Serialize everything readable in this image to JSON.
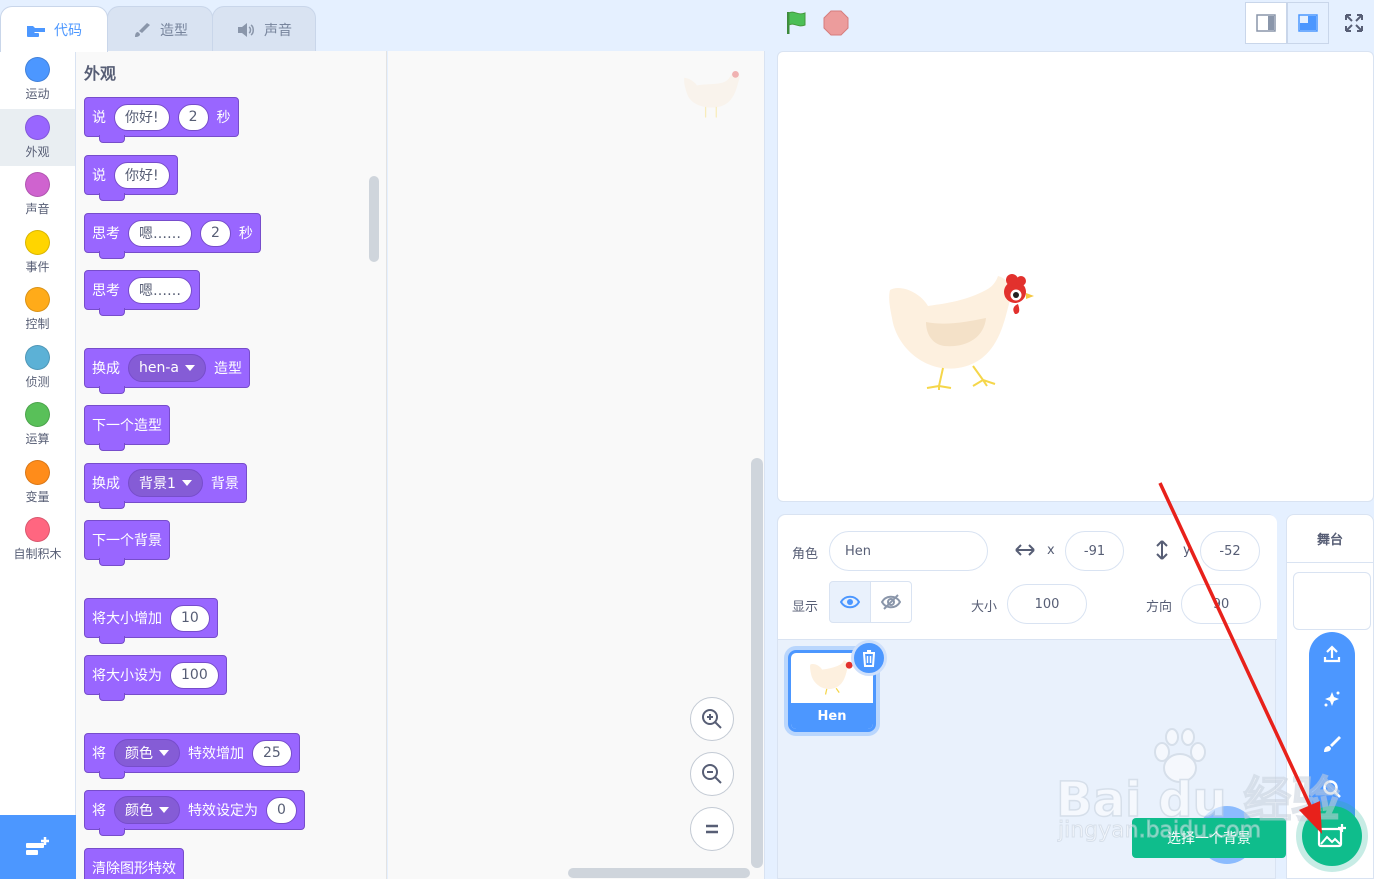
{
  "tabs": [
    {
      "label": "代码",
      "icon": "code-icon",
      "active": true
    },
    {
      "label": "造型",
      "icon": "brush-icon",
      "active": false
    },
    {
      "label": "声音",
      "icon": "speaker-icon",
      "active": false
    }
  ],
  "controls": {
    "green_flag": "green-flag-icon",
    "stop": "stop-icon"
  },
  "categories": [
    {
      "label": "运动",
      "color": "#4c97ff"
    },
    {
      "label": "外观",
      "color": "#9966ff",
      "active": true
    },
    {
      "label": "声音",
      "color": "#cf63cf"
    },
    {
      "label": "事件",
      "color": "#ffd500"
    },
    {
      "label": "控制",
      "color": "#ffab19"
    },
    {
      "label": "侦测",
      "color": "#5cb1d6"
    },
    {
      "label": "运算",
      "color": "#59c059"
    },
    {
      "label": "变量",
      "color": "#ff8c1a"
    },
    {
      "label": "自制积木",
      "color": "#ff6680"
    }
  ],
  "palette": {
    "title": "外观",
    "blocks": {
      "say_secs": {
        "t1": "说",
        "msg": "你好!",
        "secs": "2",
        "t2": "秒"
      },
      "say": {
        "t1": "说",
        "msg": "你好!"
      },
      "think_secs": {
        "t1": "思考",
        "msg": "嗯……",
        "secs": "2",
        "t2": "秒"
      },
      "think": {
        "t1": "思考",
        "msg": "嗯……"
      },
      "switch_costume": {
        "t1": "换成",
        "value": "hen-a",
        "t2": "造型"
      },
      "next_costume": {
        "t1": "下一个造型"
      },
      "switch_backdrop": {
        "t1": "换成",
        "value": "背景1",
        "t2": "背景"
      },
      "next_backdrop": {
        "t1": "下一个背景"
      },
      "change_size": {
        "t1": "将大小增加",
        "value": "10"
      },
      "set_size": {
        "t1": "将大小设为",
        "value": "100"
      },
      "change_effect": {
        "t1": "将",
        "effect": "颜色",
        "t2": "特效增加",
        "value": "25"
      },
      "set_effect": {
        "t1": "将",
        "effect": "颜色",
        "t2": "特效设定为",
        "value": "0"
      },
      "clear_effects": {
        "t1": "清除图形特效"
      }
    }
  },
  "sprite_info": {
    "sprite_label": "角色",
    "sprite_name": "Hen",
    "x_label": "x",
    "x_value": "-91",
    "y_label": "y",
    "y_value": "-52",
    "show_label": "显示",
    "size_label": "大小",
    "size_value": "100",
    "direction_label": "方向",
    "direction_value": "90"
  },
  "sprites": [
    {
      "name": "Hen"
    }
  ],
  "stage_pane": {
    "title": "舞台"
  },
  "backdrop_tooltip": "选择一个背景",
  "watermark": {
    "brand": "Bai du 经验",
    "url": "jingyan.baidu.com"
  },
  "colors": {
    "accent": "#4c97ff",
    "looks": "#9966ff",
    "green": "#0fbd8c",
    "annotation_arrow": "#e8211b"
  }
}
